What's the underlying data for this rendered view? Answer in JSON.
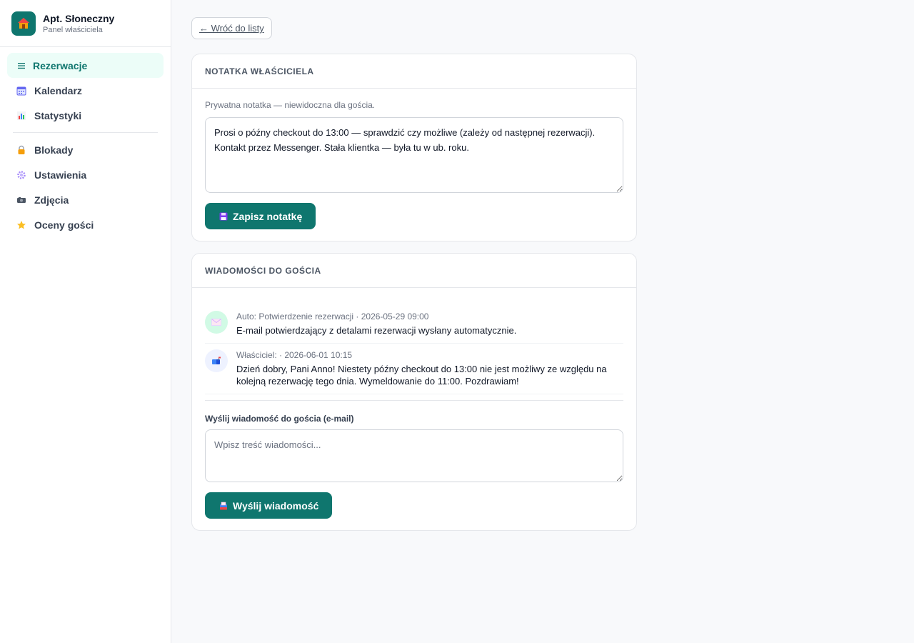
{
  "brand": {
    "name": "Apt. Słoneczny",
    "subtitle": "Panel właściciela"
  },
  "nav": {
    "items": [
      {
        "label": "Rezerwacje",
        "icon": "list-icon",
        "active": true
      },
      {
        "label": "Kalendarz",
        "icon": "calendar-icon"
      },
      {
        "label": "Statystyki",
        "icon": "bar-chart-icon"
      },
      {
        "label": "Blokady",
        "icon": "lock-icon"
      },
      {
        "label": "Ustawienia",
        "icon": "gear-icon"
      },
      {
        "label": "Zdjęcia",
        "icon": "camera-icon"
      },
      {
        "label": "Oceny gości",
        "icon": "star-icon"
      }
    ]
  },
  "back": {
    "label": "← Wróć do listy"
  },
  "note": {
    "title": "NOTATKA WŁAŚCICIELA",
    "hint": "Prywatna notatka — niewidoczna dla gościa.",
    "value": "Prosi o późny checkout do 13:00 — sprawdzić czy możliwe (zależy od następnej rezerwacji). Kontakt przez Messenger. Stała klientka — była tu w ub. roku.",
    "save_label": "Zapisz notatkę"
  },
  "messages": {
    "title": "WIADOMOŚCI DO GOŚCIA",
    "items": [
      {
        "meta": "Auto: Potwierdzenie rezerwacji · 2026-05-29 09:00",
        "text": "E-mail potwierdzający z detalami rezerwacji wysłany automatycznie.",
        "icon": "envelope-icon"
      },
      {
        "meta": "Właściciel: · 2026-06-01 10:15",
        "text": "Dzień dobry, Pani Anno! Niestety późny checkout do 13:00 nie jest możliwy ze względu na kolejną rezerwację tego dnia. Wymeldowanie do 11:00. Pozdrawiam!",
        "icon": "mailbox-icon"
      }
    ],
    "send_label": "Wyślij wiadomość do gościa (e-mail)",
    "placeholder": "Wpisz treść wiadomości...",
    "send_button": "Wyślij wiadomość"
  },
  "colors": {
    "accent": "#0f766e",
    "active_bg": "#ecfdf8"
  }
}
